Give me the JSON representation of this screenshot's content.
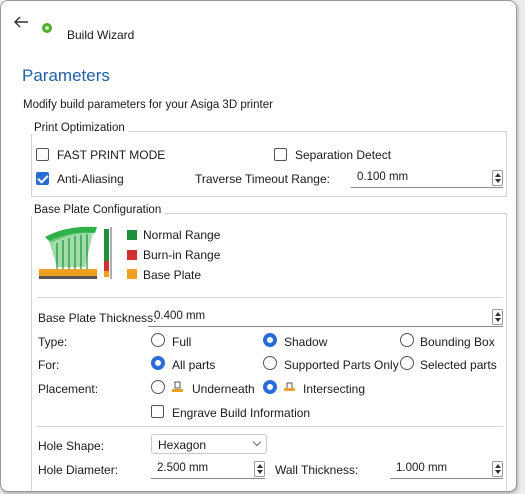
{
  "window": {
    "title": "Build Wizard"
  },
  "page": {
    "heading": "Parameters",
    "description": "Modify build parameters for your Asiga 3D printer"
  },
  "print_optimization": {
    "group_label": "Print Optimization",
    "fast_print": {
      "label": "FAST PRINT MODE",
      "checked": false
    },
    "separation_detect": {
      "label": "Separation Detect",
      "checked": false
    },
    "anti_aliasing": {
      "label": "Anti-Aliasing",
      "checked": true
    },
    "traverse_timeout": {
      "label": "Traverse Timeout Range:",
      "value": "0.100 mm"
    }
  },
  "base_plate": {
    "group_label": "Base Plate Configuration",
    "legend": [
      {
        "label": "Normal Range",
        "color": "#1e8f3a"
      },
      {
        "label": "Burn-in Range",
        "color": "#d32f2f"
      },
      {
        "label": "Base Plate",
        "color": "#f0a020"
      }
    ],
    "thickness": {
      "label": "Base Plate Thickness:",
      "value": "0.400 mm"
    },
    "type": {
      "label": "Type:",
      "options": [
        "Full",
        "Shadow",
        "Bounding Box"
      ],
      "selected": "Shadow"
    },
    "for": {
      "label": "For:",
      "options": [
        "All parts",
        "Supported Parts Only",
        "Selected parts"
      ],
      "selected": "All parts"
    },
    "placement": {
      "label": "Placement:",
      "options": [
        "Underneath",
        "Intersecting"
      ],
      "selected": "Intersecting"
    },
    "engrave": {
      "label": "Engrave Build Information",
      "checked": false
    },
    "hole_shape": {
      "label": "Hole Shape:",
      "value": "Hexagon"
    },
    "hole_diameter": {
      "label": "Hole Diameter:",
      "value": "2.500 mm"
    },
    "wall_thickness": {
      "label": "Wall Thickness:",
      "value": "1.000 mm"
    }
  },
  "colors": {
    "accent": "#2b6cd4",
    "heading": "#1f5fa8",
    "app_icon": "#4caf2a"
  }
}
